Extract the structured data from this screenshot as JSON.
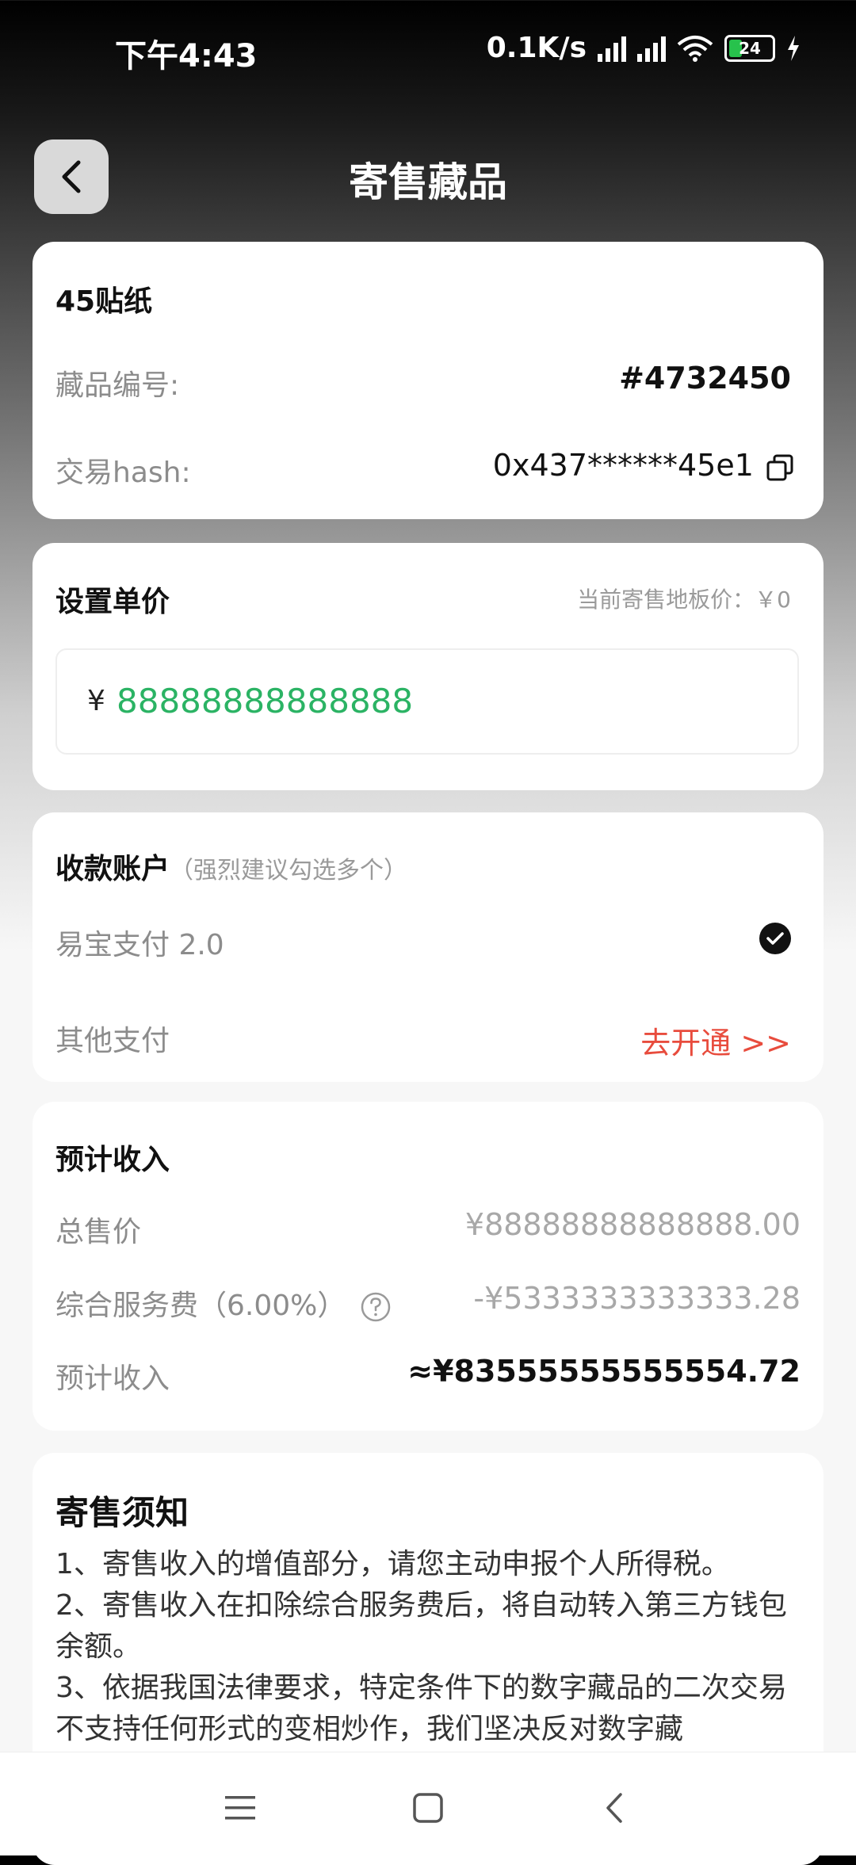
{
  "status": {
    "time": "下午4:43",
    "network_speed": "0.1K/s",
    "battery": "24"
  },
  "header": {
    "title": "寄售藏品"
  },
  "item": {
    "name": "45贴纸",
    "number_label": "藏品编号:",
    "number_value": "#4732450",
    "hash_label": "交易hash:",
    "hash_value": "0x437******45e1"
  },
  "price": {
    "title": "设置单价",
    "floor_label": "当前寄售地板价：￥0",
    "currency": "¥",
    "value": "88888888888888"
  },
  "account": {
    "title": "收款账户",
    "hint": "（强烈建议勾选多个）",
    "option1": "易宝支付 2.0",
    "option2": "其他支付",
    "activate_label": "去开通 >>"
  },
  "income": {
    "title": "预计收入",
    "total_label": "总售价",
    "total_value": "¥88888888888888.00",
    "fee_label": "综合服务费（6.00%）",
    "fee_value": "-¥5333333333333.28",
    "net_label": "预计收入",
    "net_value": "≈¥83555555555554.72"
  },
  "notice": {
    "title": "寄售须知",
    "line1": "1、寄售收入的增值部分，请您主动申报个人所得税。",
    "line2": "2、寄售收入在扣除综合服务费后，将自动转入第三方钱包余额。",
    "line3": "3、依据我国法律要求，特定条件下的数字藏品的二次交易不支持任何形式的变相炒作，我们坚决反对数字藏"
  },
  "colors": {
    "accent_green": "#2bb364",
    "link_red": "#e84c3d",
    "battery_green": "#27c24c"
  }
}
